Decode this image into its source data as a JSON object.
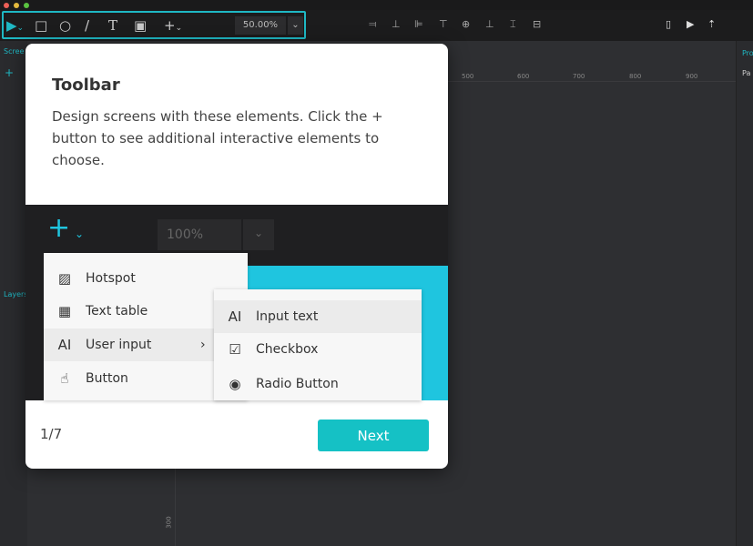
{
  "toolbar": {
    "zoom": "50.00%",
    "tools": [
      "select-icon",
      "rectangle-icon",
      "ellipse-icon",
      "line-icon",
      "text-icon",
      "image-icon",
      "plus-icon"
    ]
  },
  "left_panel": {
    "tab_screens": "Scree",
    "tab_layers": "Layers"
  },
  "right_panel": {
    "tab": "Pro",
    "item": "Pa"
  },
  "ruler": {
    "ticks": [
      "500",
      "600",
      "700",
      "800",
      "900"
    ],
    "vertical_tick": "300"
  },
  "modal": {
    "title": "Toolbar",
    "body": "Design screens with these elements. Click the + button to see additional interactive elements to choose.",
    "preview_zoom": "100%",
    "menu": [
      {
        "label": "Hotspot",
        "icon": "hotspot-icon"
      },
      {
        "label": "Text table",
        "icon": "table-icon"
      },
      {
        "label": "User input",
        "icon": "input-icon"
      },
      {
        "label": "Button",
        "icon": "button-icon"
      }
    ],
    "submenu": [
      {
        "label": "Input text",
        "icon": "AI"
      },
      {
        "label": "Checkbox",
        "icon": "☑"
      },
      {
        "label": "Radio Button",
        "icon": "◉"
      }
    ],
    "counter": "1/7",
    "next": "Next"
  },
  "colors": {
    "accent": "#1fb8c4",
    "banner": "#1fc5df",
    "next": "#15c1c5"
  }
}
